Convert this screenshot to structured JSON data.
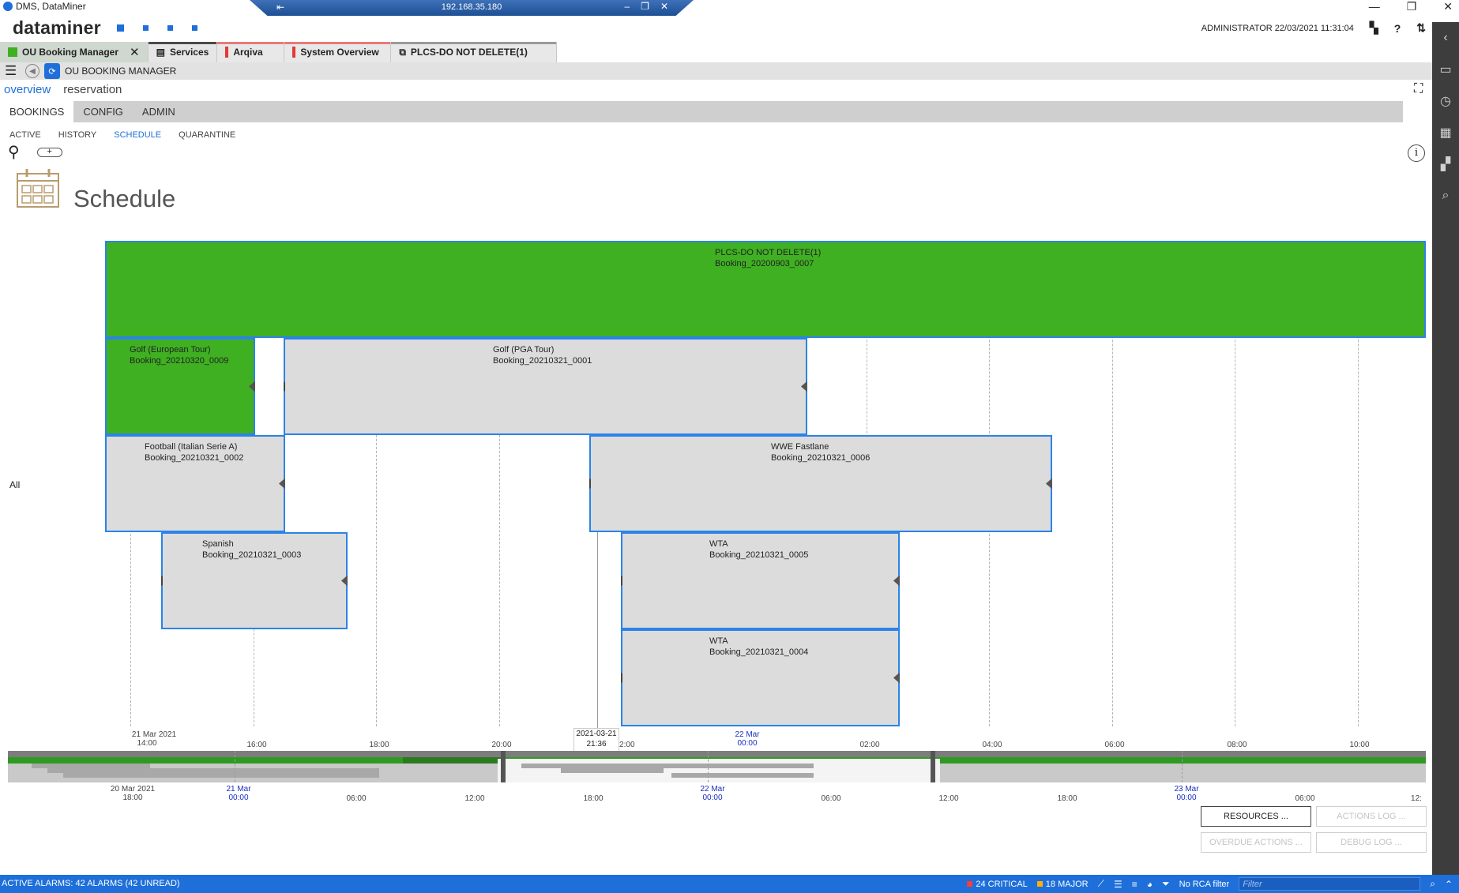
{
  "window": {
    "title": "DMS, DataMiner",
    "remote_ip": "192.168.35.180",
    "minimize_glyph": "—",
    "maximize_glyph": "❐",
    "close_glyph": "✕"
  },
  "header": {
    "brand": "dataminer",
    "user_info": "ADMINISTRATOR 22/03/2021 11:31:04",
    "help_glyph": "?"
  },
  "card_tabs": [
    {
      "label": "OU Booking Manager",
      "active": true,
      "color": "#3fb022"
    },
    {
      "label": "Services",
      "active": false
    },
    {
      "label": "Arqiva",
      "active": false
    },
    {
      "label": "System Overview",
      "active": false
    },
    {
      "label": "PLCS-DO NOT DELETE(1)",
      "active": false
    }
  ],
  "nav": {
    "app_title": "OU BOOKING MANAGER"
  },
  "page_tabs": [
    {
      "label": "overview",
      "active": true
    },
    {
      "label": "reservation",
      "active": false
    }
  ],
  "sub_tabs": [
    {
      "label": "BOOKINGS",
      "active": true
    },
    {
      "label": "CONFIG",
      "active": false
    },
    {
      "label": "ADMIN",
      "active": false
    }
  ],
  "view_tabs": [
    {
      "label": "ACTIVE",
      "active": false
    },
    {
      "label": "HISTORY",
      "active": false
    },
    {
      "label": "SCHEDULE",
      "active": true
    },
    {
      "label": "QUARANTINE",
      "active": false
    }
  ],
  "add_button_glyph": "+",
  "info_glyph": "i",
  "schedule": {
    "title": "Schedule",
    "group_label": "All",
    "now_label": {
      "date": "2021-03-21",
      "time": "21:36"
    },
    "bookings": [
      {
        "name": "PLCS-DO NOT DELETE(1)",
        "id": "Booking_20200903_0007",
        "state": "running",
        "color": "#3fb022"
      },
      {
        "name": "Golf (European Tour)",
        "id": "Booking_20210320_0009",
        "state": "running",
        "color": "#3fb022"
      },
      {
        "name": "Golf (PGA Tour)",
        "id": "Booking_20210321_0001",
        "state": "scheduled"
      },
      {
        "name": "Football (Italian Serie A)",
        "id": "Booking_20210321_0002",
        "state": "scheduled"
      },
      {
        "name": "WWE Fastlane",
        "id": "Booking_20210321_0006",
        "state": "scheduled"
      },
      {
        "name": "Spanish",
        "id": "Booking_20210321_0003",
        "state": "scheduled"
      },
      {
        "name": "WTA",
        "id": "Booking_20210321_0005",
        "state": "scheduled"
      },
      {
        "name": "WTA",
        "id": "Booking_20210321_0004",
        "state": "scheduled"
      }
    ],
    "axis_ticks": [
      {
        "label": "14:00",
        "sub": "21 Mar 2021",
        "day": false
      },
      {
        "label": "16:00",
        "sub": "",
        "day": false
      },
      {
        "label": "18:00",
        "sub": "",
        "day": false
      },
      {
        "label": "20:00",
        "sub": "",
        "day": false
      },
      {
        "label": "22:00",
        "sub": "",
        "day": false
      },
      {
        "label": "00:00",
        "sub": "22 Mar",
        "day": true
      },
      {
        "label": "02:00",
        "sub": "",
        "day": false
      },
      {
        "label": "04:00",
        "sub": "",
        "day": false
      },
      {
        "label": "06:00",
        "sub": "",
        "day": false
      },
      {
        "label": "08:00",
        "sub": "",
        "day": false
      },
      {
        "label": "10:00",
        "sub": "",
        "day": false
      }
    ],
    "overview_ticks": [
      {
        "label": "18:00",
        "sub": "20 Mar 2021",
        "day": false
      },
      {
        "label": "00:00",
        "sub": "21 Mar",
        "day": true
      },
      {
        "label": "06:00",
        "sub": "",
        "day": false
      },
      {
        "label": "12:00",
        "sub": "",
        "day": false
      },
      {
        "label": "18:00",
        "sub": "",
        "day": false
      },
      {
        "label": "00:00",
        "sub": "22 Mar",
        "day": true
      },
      {
        "label": "06:00",
        "sub": "",
        "day": false
      },
      {
        "label": "12:00",
        "sub": "",
        "day": false
      },
      {
        "label": "18:00",
        "sub": "",
        "day": false
      },
      {
        "label": "00:00",
        "sub": "23 Mar",
        "day": true
      },
      {
        "label": "06:00",
        "sub": "",
        "day": false
      },
      {
        "label": "12:",
        "sub": "",
        "day": false
      }
    ]
  },
  "buttons": {
    "resources": "RESOURCES ...",
    "actions_log": "ACTIONS LOG ...",
    "overdue_actions": "OVERDUE ACTIONS ...",
    "debug_log": "DEBUG LOG ..."
  },
  "status": {
    "alarms": "ACTIVE ALARMS: 42 ALARMS (42 UNREAD)",
    "critical": "24 CRITICAL",
    "major": "18 MAJOR",
    "rca": "No RCA filter",
    "filter_placeholder": "Filter"
  }
}
